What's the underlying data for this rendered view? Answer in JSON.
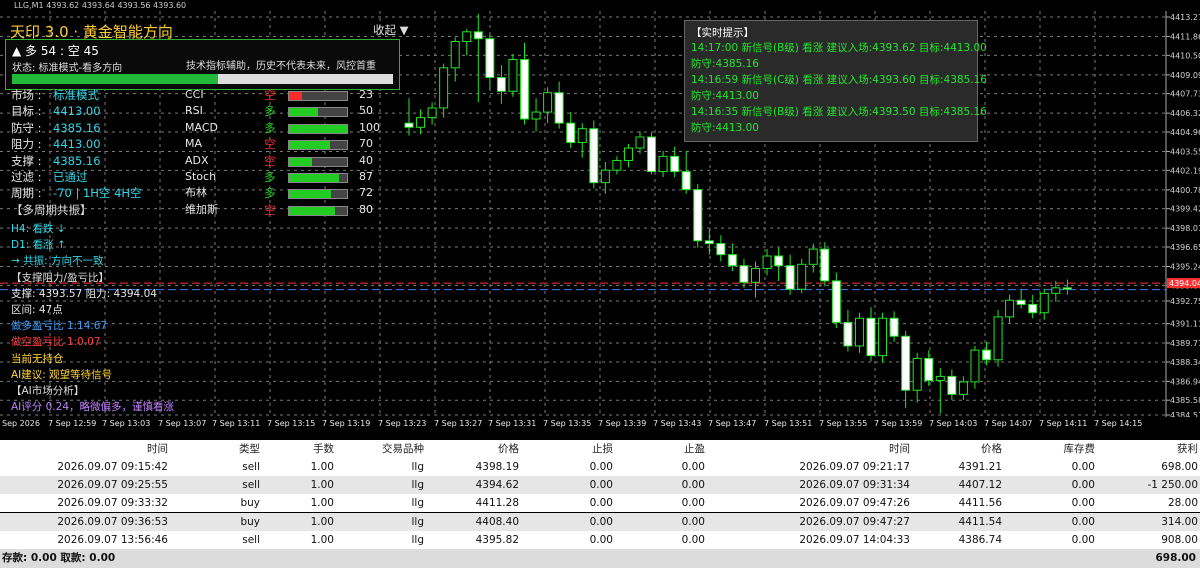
{
  "window": {
    "title": "LLG,M1  4393.62 4393.64 4393.56 4393.60"
  },
  "app_title": "天印 3.0 · 黄金智能方向",
  "collapse_label": "收起 ▼",
  "summary": {
    "counts": "▲ 多 54 : 空 45",
    "status": "状态: 标准模式-看多方向",
    "disclaimer": "技术指标辅助，历史不代表未来，风控首重",
    "progress_pct": 54
  },
  "info": [
    {
      "label": "市场 : ",
      "value": "标准模式",
      "color": "cyan"
    },
    {
      "label": "目标 : ",
      "value": "4413.00",
      "color": "cyan"
    },
    {
      "label": "防守 : ",
      "value": "4385.16",
      "color": "cyan"
    },
    {
      "label": "阻力 : ",
      "value": "4413.00",
      "color": "cyan"
    },
    {
      "label": "支撑 : ",
      "value": "4385.16",
      "color": "cyan"
    },
    {
      "label": "过滤 : ",
      "value": "已通过",
      "color": "cyan"
    },
    {
      "label": "周期 : ",
      "value": "-70 | 1H空 4H空",
      "color": "cyan"
    }
  ],
  "indicators": [
    {
      "name": "CCI",
      "dir": "空",
      "dir_color": "#ff2a2a",
      "bar_pct": 23,
      "bar_color": "#ff2a2a",
      "value": "23"
    },
    {
      "name": "RSI",
      "dir": "多",
      "dir_color": "#22cc22",
      "bar_pct": 50,
      "bar_color": "#22cc22",
      "value": "50"
    },
    {
      "name": "MACD",
      "dir": "多",
      "dir_color": "#22cc22",
      "bar_pct": 100,
      "bar_color": "#22cc22",
      "value": "100"
    },
    {
      "name": "MA",
      "dir": "空",
      "dir_color": "#ff2a2a",
      "bar_pct": 70,
      "bar_color": "#22cc22",
      "value": "70"
    },
    {
      "name": "ADX",
      "dir": "空",
      "dir_color": "#ff2a2a",
      "bar_pct": 40,
      "bar_color": "#22cc22",
      "value": "40"
    },
    {
      "name": "Stoch",
      "dir": "多",
      "dir_color": "#22cc22",
      "bar_pct": 87,
      "bar_color": "#22cc22",
      "value": "87"
    },
    {
      "name": "布林",
      "dir": "多",
      "dir_color": "#22cc22",
      "bar_pct": 72,
      "bar_color": "#22cc22",
      "value": "72"
    },
    {
      "name": "维加斯",
      "dir": "空",
      "dir_color": "#ff2a2a",
      "bar_pct": 80,
      "bar_color": "#22cc22",
      "value": "80"
    }
  ],
  "multi_period": {
    "title": "【多周期共振】",
    "h4": "H4: 看跌 ↓",
    "d1": "D1: 看涨 ↑",
    "resonance": "→ 共振: 方向不一致"
  },
  "sr": {
    "title": "【支撑阻力/盈亏比】",
    "line": "支撑: 4393.57  阻力: 4394.04",
    "range": "区间: 47点",
    "long_ratio": "做多盈亏比 1:14.67",
    "short_ratio": "做空盈亏比 1:0.07",
    "position": "当前无持仓",
    "advice": "AI建议: 观望等待信号"
  },
  "ai": {
    "title": "【AI市场分析】",
    "score": "AI评分 0.24，略微偏多，谨慎看涨"
  },
  "tooltip": {
    "title": "【实时提示】",
    "lines": [
      "14:17:00 新信号(B级) 看涨 建议入场:4393.62 目标:4413.00",
      "防守:4385.16",
      "14:16:59 新信号(C级) 看涨 建议入场:4393.60 目标:4385.16",
      "防守:4413.00",
      "14:16:35 新信号(B级) 看涨 建议入场:4393.50 目标:4385.16",
      "防守:4413.00"
    ]
  },
  "chart_data": {
    "type": "candlestick",
    "symbol": "LLG,M1",
    "ylim": [
      4384.51,
      4413.27
    ],
    "y_ticks": [
      "4413.27",
      "4411.86",
      "4410.50",
      "4409.09",
      "4407.73",
      "4406.32",
      "4404.96",
      "4403.55",
      "4402.19",
      "4400.78",
      "4399.42",
      "4398.01",
      "4396.65",
      "4395.24",
      "4393.88",
      "4392.75",
      "4391.11",
      "4389.71",
      "4388.34",
      "4386.94",
      "4385.58",
      "4384.51"
    ],
    "current_price": "4394.04",
    "resistance": 4394.04,
    "support": 4393.57,
    "x_ticks": [
      "Sep 2026",
      "7 Sep 12:59",
      "7 Sep 13:03",
      "7 Sep 13:07",
      "7 Sep 13:11",
      "7 Sep 13:15",
      "7 Sep 13:19",
      "7 Sep 13:23",
      "7 Sep 13:27",
      "7 Sep 13:31",
      "7 Sep 13:35",
      "7 Sep 13:39",
      "7 Sep 13:43",
      "7 Sep 13:47",
      "7 Sep 13:51",
      "7 Sep 13:55",
      "7 Sep 13:59",
      "7 Sep 14:03",
      "7 Sep 14:07",
      "7 Sep 14:11",
      "7 Sep 14:15"
    ],
    "candles": [
      [
        4405.6,
        4407.4,
        4404.7,
        4405.3
      ],
      [
        4405.3,
        4406.6,
        4404.8,
        4406.0
      ],
      [
        4406.0,
        4407.1,
        4405.5,
        4406.7
      ],
      [
        4406.7,
        4409.9,
        4406.0,
        4409.6
      ],
      [
        4409.6,
        4411.8,
        4408.6,
        4411.5
      ],
      [
        4411.5,
        4412.4,
        4410.5,
        4412.2
      ],
      [
        4412.2,
        4413.5,
        4407.1,
        4411.7
      ],
      [
        4411.7,
        4412.0,
        4408.0,
        4408.9
      ],
      [
        4408.9,
        4409.8,
        4407.0,
        4407.9
      ],
      [
        4407.9,
        4410.6,
        4407.5,
        4410.2
      ],
      [
        4410.2,
        4411.4,
        4405.5,
        4405.9
      ],
      [
        4405.9,
        4407.4,
        4405.0,
        4406.4
      ],
      [
        4406.4,
        4408.2,
        4405.6,
        4407.8
      ],
      [
        4407.8,
        4408.6,
        4405.2,
        4405.6
      ],
      [
        4405.6,
        4406.4,
        4403.8,
        4404.2
      ],
      [
        4404.2,
        4405.6,
        4403.1,
        4405.2
      ],
      [
        4405.2,
        4405.8,
        4400.9,
        4401.3
      ],
      [
        4401.3,
        4402.8,
        4400.5,
        4402.2
      ],
      [
        4402.2,
        4403.2,
        4401.9,
        4402.9
      ],
      [
        4402.9,
        4404.1,
        4402.4,
        4403.8
      ],
      [
        4403.8,
        4405.0,
        4403.4,
        4404.6
      ],
      [
        4404.6,
        4404.9,
        4401.9,
        4402.1
      ],
      [
        4402.1,
        4403.6,
        4401.7,
        4403.2
      ],
      [
        4403.2,
        4403.9,
        4401.7,
        4402.1
      ],
      [
        4402.1,
        4403.6,
        4400.5,
        4400.8
      ],
      [
        4400.8,
        4401.2,
        4396.6,
        4397.1
      ],
      [
        4397.1,
        4397.9,
        4396.1,
        4396.9
      ],
      [
        4396.9,
        4397.5,
        4395.6,
        4396.1
      ],
      [
        4396.1,
        4396.9,
        4394.9,
        4395.3
      ],
      [
        4395.3,
        4395.8,
        4393.7,
        4394.1
      ],
      [
        4394.1,
        4395.6,
        4393.0,
        4395.1
      ],
      [
        4395.1,
        4396.5,
        4394.6,
        4396.0
      ],
      [
        4396.0,
        4396.6,
        4394.2,
        4395.3
      ],
      [
        4395.3,
        4396.1,
        4393.2,
        4393.6
      ],
      [
        4393.6,
        4395.8,
        4393.3,
        4395.4
      ],
      [
        4395.4,
        4396.9,
        4394.8,
        4396.5
      ],
      [
        4396.5,
        4397.0,
        4393.8,
        4394.2
      ],
      [
        4394.2,
        4394.8,
        4390.8,
        4391.2
      ],
      [
        4391.2,
        4392.1,
        4389.1,
        4389.5
      ],
      [
        4389.5,
        4391.9,
        4389.0,
        4391.5
      ],
      [
        4391.5,
        4392.3,
        4388.4,
        4388.8
      ],
      [
        4388.8,
        4391.9,
        4388.3,
        4391.5
      ],
      [
        4391.5,
        4392.0,
        4389.8,
        4390.2
      ],
      [
        4390.2,
        4390.6,
        4385.0,
        4386.3
      ],
      [
        4386.3,
        4389.0,
        4385.4,
        4388.6
      ],
      [
        4388.6,
        4389.2,
        4386.6,
        4387.0
      ],
      [
        4387.0,
        4387.9,
        4384.6,
        4387.3
      ],
      [
        4387.3,
        4387.8,
        4385.6,
        4386.0
      ],
      [
        4386.0,
        4387.3,
        4385.6,
        4386.9
      ],
      [
        4386.9,
        4389.5,
        4386.4,
        4389.2
      ],
      [
        4389.2,
        4389.8,
        4388.1,
        4388.5
      ],
      [
        4388.5,
        4392.1,
        4388.0,
        4391.6
      ],
      [
        4391.6,
        4393.2,
        4391.1,
        4392.8
      ],
      [
        4392.8,
        4393.6,
        4392.2,
        4392.5
      ],
      [
        4392.5,
        4393.2,
        4391.5,
        4391.9
      ],
      [
        4391.9,
        4393.6,
        4391.4,
        4393.3
      ],
      [
        4393.3,
        4394.2,
        4392.7,
        4393.7
      ],
      [
        4393.7,
        4394.3,
        4393.2,
        4393.6
      ]
    ]
  },
  "table": {
    "headers": [
      "时间",
      "类型",
      "手数",
      "交易品种",
      "价格",
      "止损",
      "止盈",
      "时间",
      "价格",
      "库存费",
      "获利"
    ],
    "rows": [
      [
        "2026.09.07 09:15:42",
        "sell",
        "1.00",
        "llg",
        "4398.19",
        "0.00",
        "0.00",
        "2026.09.07 09:21:17",
        "4391.21",
        "0.00",
        "698.00"
      ],
      [
        "2026.09.07 09:25:55",
        "sell",
        "1.00",
        "llg",
        "4394.62",
        "0.00",
        "0.00",
        "2026.09.07 09:31:34",
        "4407.12",
        "0.00",
        "-1 250.00"
      ],
      [
        "2026.09.07 09:33:32",
        "buy",
        "1.00",
        "llg",
        "4411.28",
        "0.00",
        "0.00",
        "2026.09.07 09:47:26",
        "4411.56",
        "0.00",
        "28.00"
      ],
      [
        "2026.09.07 09:36:53",
        "buy",
        "1.00",
        "llg",
        "4408.40",
        "0.00",
        "0.00",
        "2026.09.07 09:47:27",
        "4411.54",
        "0.00",
        "314.00"
      ],
      [
        "2026.09.07 13:56:46",
        "sell",
        "1.00",
        "llg",
        "4395.82",
        "0.00",
        "0.00",
        "2026.09.07 14:04:33",
        "4386.74",
        "0.00",
        "908.00"
      ]
    ]
  },
  "footer": {
    "text": "存款: 0.00  取款: 0.00",
    "total": "698.00"
  }
}
